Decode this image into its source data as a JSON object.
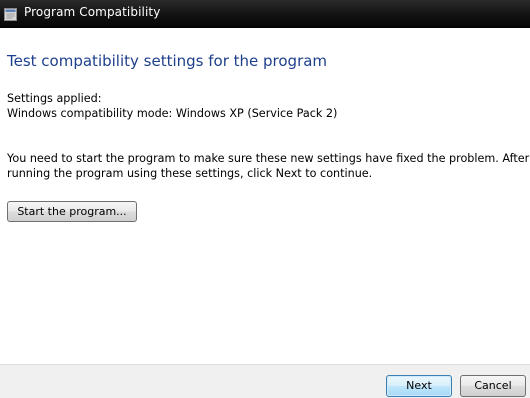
{
  "window": {
    "title": "Program Compatibility",
    "icon": "program-icon"
  },
  "main": {
    "heading": "Test compatibility settings for the program",
    "settings_label": "Settings applied:",
    "settings_value": "Windows compatibility mode: Windows XP (Service Pack 2)",
    "instructions_line1": "You need to start the program to make sure these new settings have fixed the problem. After",
    "instructions_line2": "running the program using these settings, click Next to continue.",
    "start_button_label": "Start the program..."
  },
  "footer": {
    "next_label": "Next",
    "cancel_label": "Cancel"
  },
  "colors": {
    "heading": "#1e3f8c",
    "titlebar": "#141414",
    "footer_background": "#f0f0f0",
    "default_button_border": "#3c7fb1"
  }
}
